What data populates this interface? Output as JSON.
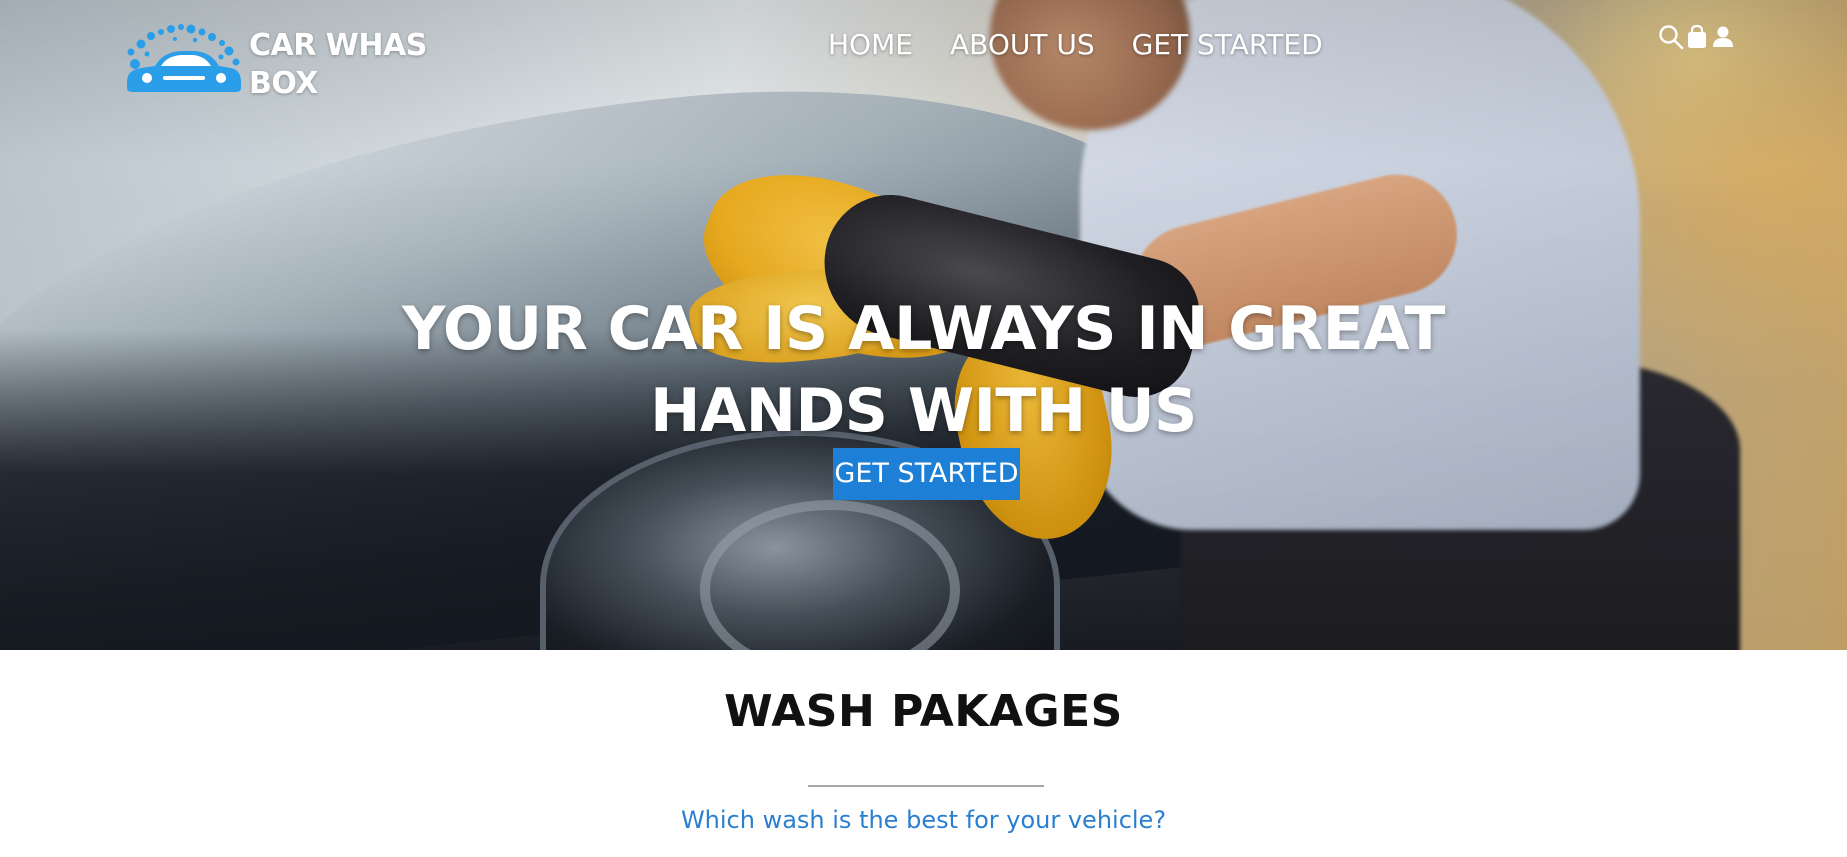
{
  "brand": {
    "name_line1": "CAR WHAS",
    "name_line2": "BOX",
    "logo_icon": "car-wash-bubbles-icon"
  },
  "nav": {
    "items": [
      {
        "label": "HOME"
      },
      {
        "label": "ABOUT US"
      },
      {
        "label": "GET STARTED"
      }
    ]
  },
  "header_icons": [
    "search-icon",
    "shopping-bag-icon",
    "user-icon"
  ],
  "hero": {
    "title_line1": "YOUR CAR IS ALWAYS IN GREAT",
    "title_line2": "HANDS WITH US",
    "button_label": "GET STARTED"
  },
  "packages": {
    "title": "WASH PAKAGES",
    "subtitle": "Which wash is the best for your vehicle?"
  },
  "colors": {
    "accent": "#1e7fd6",
    "subtitle": "#2a7fd0",
    "logo_blue": "#2a9ee8",
    "text_dark": "#111111"
  }
}
